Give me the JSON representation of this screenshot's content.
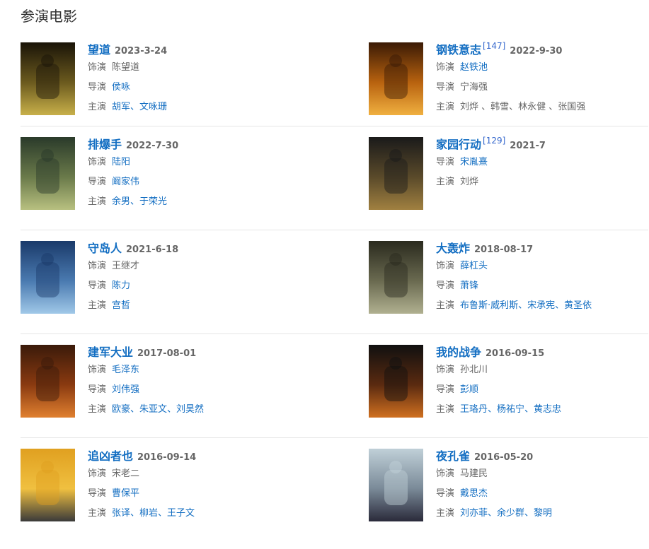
{
  "section_title": "参演电影",
  "labels": {
    "role": "饰演",
    "director": "导演",
    "cast": "主演"
  },
  "films": [
    {
      "name": "望道",
      "ref": "",
      "date": "2023-3-24",
      "role": "陈望道",
      "director": "侯咏",
      "cast": "胡军、文咏珊",
      "poster_colors": [
        "#1a1408",
        "#6b5a1e",
        "#c8b04a"
      ]
    },
    {
      "name": "钢铁意志",
      "ref": "[147]",
      "date": "2022-9-30",
      "role": "赵铁池",
      "director": "宁海强",
      "cast": "刘烨 、韩雪、林永健 、张国强",
      "poster_colors": [
        "#3a1a05",
        "#b8620f",
        "#f0b040"
      ]
    },
    {
      "name": "排爆手",
      "ref": "",
      "date": "2022-7-30",
      "role": "陆阳",
      "director": "阚家伟",
      "cast": "余男、于荣光",
      "poster_colors": [
        "#2a3a2a",
        "#6a7a4a",
        "#b8c080"
      ]
    },
    {
      "name": "家园行动",
      "ref": "[129]",
      "date": "2021-7",
      "role": "",
      "director": "宋胤熹",
      "cast": "刘烨",
      "poster_colors": [
        "#1a1a1a",
        "#5a4a2a",
        "#a08040"
      ]
    },
    {
      "name": "守岛人",
      "ref": "",
      "date": "2021-6-18",
      "role": "王继才",
      "director": "陈力",
      "cast": "宫哲",
      "poster_colors": [
        "#1a3a6a",
        "#4a7ab0",
        "#a0c8e8"
      ]
    },
    {
      "name": "大轰炸",
      "ref": "",
      "date": "2018-08-17",
      "role": "薛杠头",
      "director": "萧锋",
      "cast": "布鲁斯·威利斯、宋承宪、黄圣依",
      "poster_colors": [
        "#2a2a1e",
        "#6a6a50",
        "#b0b090"
      ]
    },
    {
      "name": "建军大业",
      "ref": "",
      "date": "2017-08-01",
      "role": "毛泽东",
      "director": "刘伟强",
      "cast": "欧豪、朱亚文、刘昊然",
      "poster_colors": [
        "#3a1a0a",
        "#8a3a10",
        "#e08030"
      ]
    },
    {
      "name": "我的战争",
      "ref": "",
      "date": "2016-09-15",
      "role": "孙北川",
      "director": "彭顺",
      "cast": "王珞丹、杨祐宁、黄志忠",
      "poster_colors": [
        "#101010",
        "#5a2a10",
        "#d07020"
      ]
    },
    {
      "name": "追凶者也",
      "ref": "",
      "date": "2016-09-14",
      "role": "宋老二",
      "director": "曹保平",
      "cast": "张译、柳岩、王子文",
      "poster_colors": [
        "#e0a020",
        "#f0c040",
        "#3a3a3a"
      ]
    },
    {
      "name": "夜孔雀",
      "ref": "",
      "date": "2016-05-20",
      "role": "马建民",
      "director": "戴思杰",
      "cast": "刘亦菲、余少群、黎明",
      "poster_colors": [
        "#c0d0d8",
        "#7a8a98",
        "#2a2a3a"
      ]
    }
  ]
}
